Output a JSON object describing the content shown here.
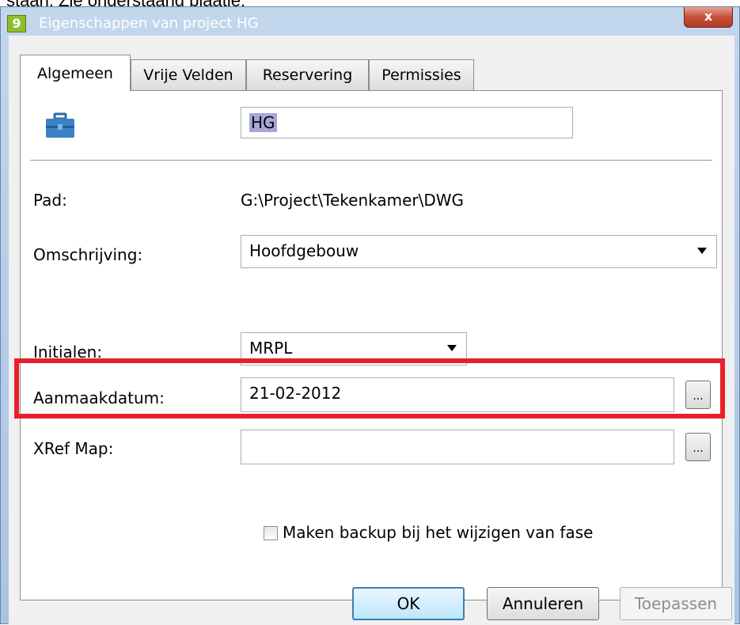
{
  "caption": "staan. Zie onderstaand plaatje:",
  "window": {
    "title": "Eigenschappen van project HG",
    "app_icon": "app-logo-icon",
    "close_label": "x"
  },
  "tabs": [
    {
      "label": "Algemeen",
      "active": true
    },
    {
      "label": "Vrije Velden",
      "active": false
    },
    {
      "label": "Reservering",
      "active": false
    },
    {
      "label": "Permissies",
      "active": false
    }
  ],
  "general": {
    "project_icon": "briefcase-icon",
    "name_value": "HG",
    "path_label": "Pad:",
    "path_value": "G:\\Project\\Tekenkamer\\DWG",
    "description_label": "Omschrijving:",
    "description_value": "Hoofdgebouw",
    "initials_label": "Initialen:",
    "initials_value": "MRPL",
    "created_label": "Aanmaakdatum:",
    "created_value": "21-02-2012",
    "browse_label": "...",
    "xref_label": "XRef Map:",
    "xref_value": "",
    "backup_label": "Maken backup bij het wijzigen van fase",
    "backup_checked": false
  },
  "buttons": {
    "ok": "OK",
    "cancel": "Annuleren",
    "apply": "Toepassen"
  },
  "colors": {
    "highlight": "#e8202a",
    "selection": "#a6a6d8",
    "app_icon": "#8dbf2d"
  }
}
